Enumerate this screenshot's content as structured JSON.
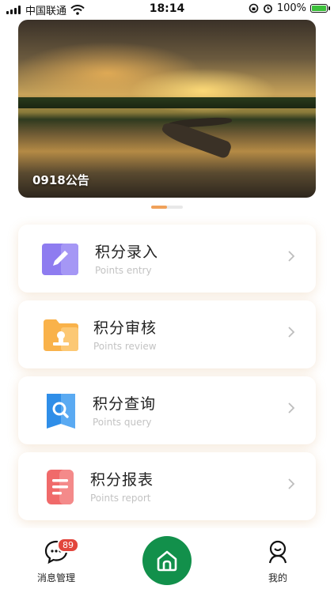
{
  "status_bar": {
    "carrier": "中国联通",
    "time": "18:14",
    "battery_percent": "100%"
  },
  "banner": {
    "title": "0918公告",
    "pages": 2,
    "active_page": 1
  },
  "menu": [
    {
      "title": "积分录入",
      "subtitle": "Points entry",
      "icon": "pencil-icon",
      "color": "#8e7cf0"
    },
    {
      "title": "积分审核",
      "subtitle": "Points review",
      "icon": "folder-stamp-icon",
      "color": "#f9b24a"
    },
    {
      "title": "积分查询",
      "subtitle": "Points query",
      "icon": "search-icon",
      "color": "#2f8ee8"
    },
    {
      "title": "积分报表",
      "subtitle": "Points report",
      "icon": "report-icon",
      "color": "#f06a6a"
    }
  ],
  "tab_bar": {
    "messages": {
      "label": "消息管理",
      "badge": "89"
    },
    "home": {
      "icon": "home-icon",
      "color": "#12904b"
    },
    "me": {
      "label": "我的"
    }
  }
}
